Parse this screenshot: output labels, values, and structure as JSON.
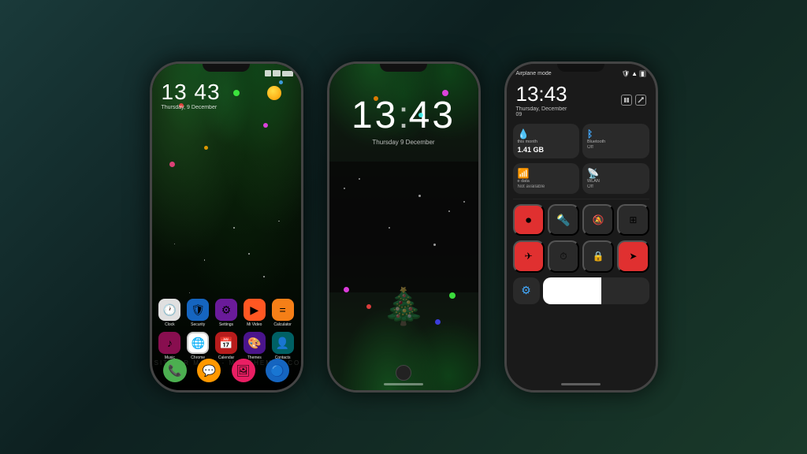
{
  "background": {
    "gradient": "teal-dark"
  },
  "phone1": {
    "type": "home_screen",
    "status_bar": {
      "icons": [
        "signal",
        "wifi",
        "battery"
      ]
    },
    "time": "13 43",
    "date": "Thursday, 9 December",
    "apps_row1": [
      {
        "label": "Clock",
        "color": "#e8e8e8",
        "emoji": "🕐"
      },
      {
        "label": "Security",
        "color": "#2196F3",
        "emoji": "🛡️"
      },
      {
        "label": "Settings",
        "color": "#9C27B0",
        "emoji": "⚙️"
      },
      {
        "label": "Mi Video",
        "color": "#FF5722",
        "emoji": "▶️"
      },
      {
        "label": "Calculator",
        "color": "#FF9800",
        "emoji": "🔢"
      }
    ],
    "apps_row2": [
      {
        "label": "Music",
        "color": "#E91E63",
        "emoji": "🎵"
      },
      {
        "label": "Chrome",
        "color": "#4CAF50",
        "emoji": "🌐"
      },
      {
        "label": "Calendar",
        "color": "#F44336",
        "emoji": "📅"
      },
      {
        "label": "Themes",
        "color": "#9C27B0",
        "emoji": "🎨"
      },
      {
        "label": "Contacts",
        "color": "#00BCD4",
        "emoji": "👤"
      }
    ],
    "dock": [
      {
        "label": "Phone",
        "color": "#4CAF50",
        "emoji": "📞"
      },
      {
        "label": "Messages",
        "color": "#FF9800",
        "emoji": "💬"
      },
      {
        "label": "Gallery",
        "color": "#E91E63",
        "emoji": "🖼️"
      },
      {
        "label": "Browser",
        "color": "#2196F3",
        "emoji": "🔵"
      }
    ]
  },
  "phone2": {
    "type": "lock_screen",
    "time": "13",
    "time2": "43",
    "colon": ":",
    "date": "Thursday 9 December"
  },
  "phone3": {
    "type": "control_center",
    "status": {
      "airplane": "Airplane mode",
      "icons": [
        "shield",
        "wifi",
        "battery"
      ]
    },
    "time": "13:43",
    "date": "Thursday, December 09",
    "data_card": {
      "title": "this month",
      "value": "1.41 GB",
      "status": ""
    },
    "bluetooth_card": {
      "label": "Bluetooth",
      "status": "Off"
    },
    "mobile_card": {
      "label": "e data",
      "status": "Not available"
    },
    "wlan_card": {
      "label": "WLAN",
      "status": "Off"
    },
    "buttons_row1": [
      {
        "icon": "⏺",
        "active": true
      },
      {
        "icon": "🔦",
        "active": false
      },
      {
        "icon": "🔔",
        "active": false
      },
      {
        "icon": "📷",
        "active": false
      }
    ],
    "buttons_row2": [
      {
        "icon": "✈",
        "active": true
      },
      {
        "icon": "⏱",
        "active": false
      },
      {
        "icon": "🔒",
        "active": false
      },
      {
        "icon": "➤",
        "active": true
      }
    ]
  },
  "watermark": "VISIT FOR MORE - MIUITHEMER.COM"
}
